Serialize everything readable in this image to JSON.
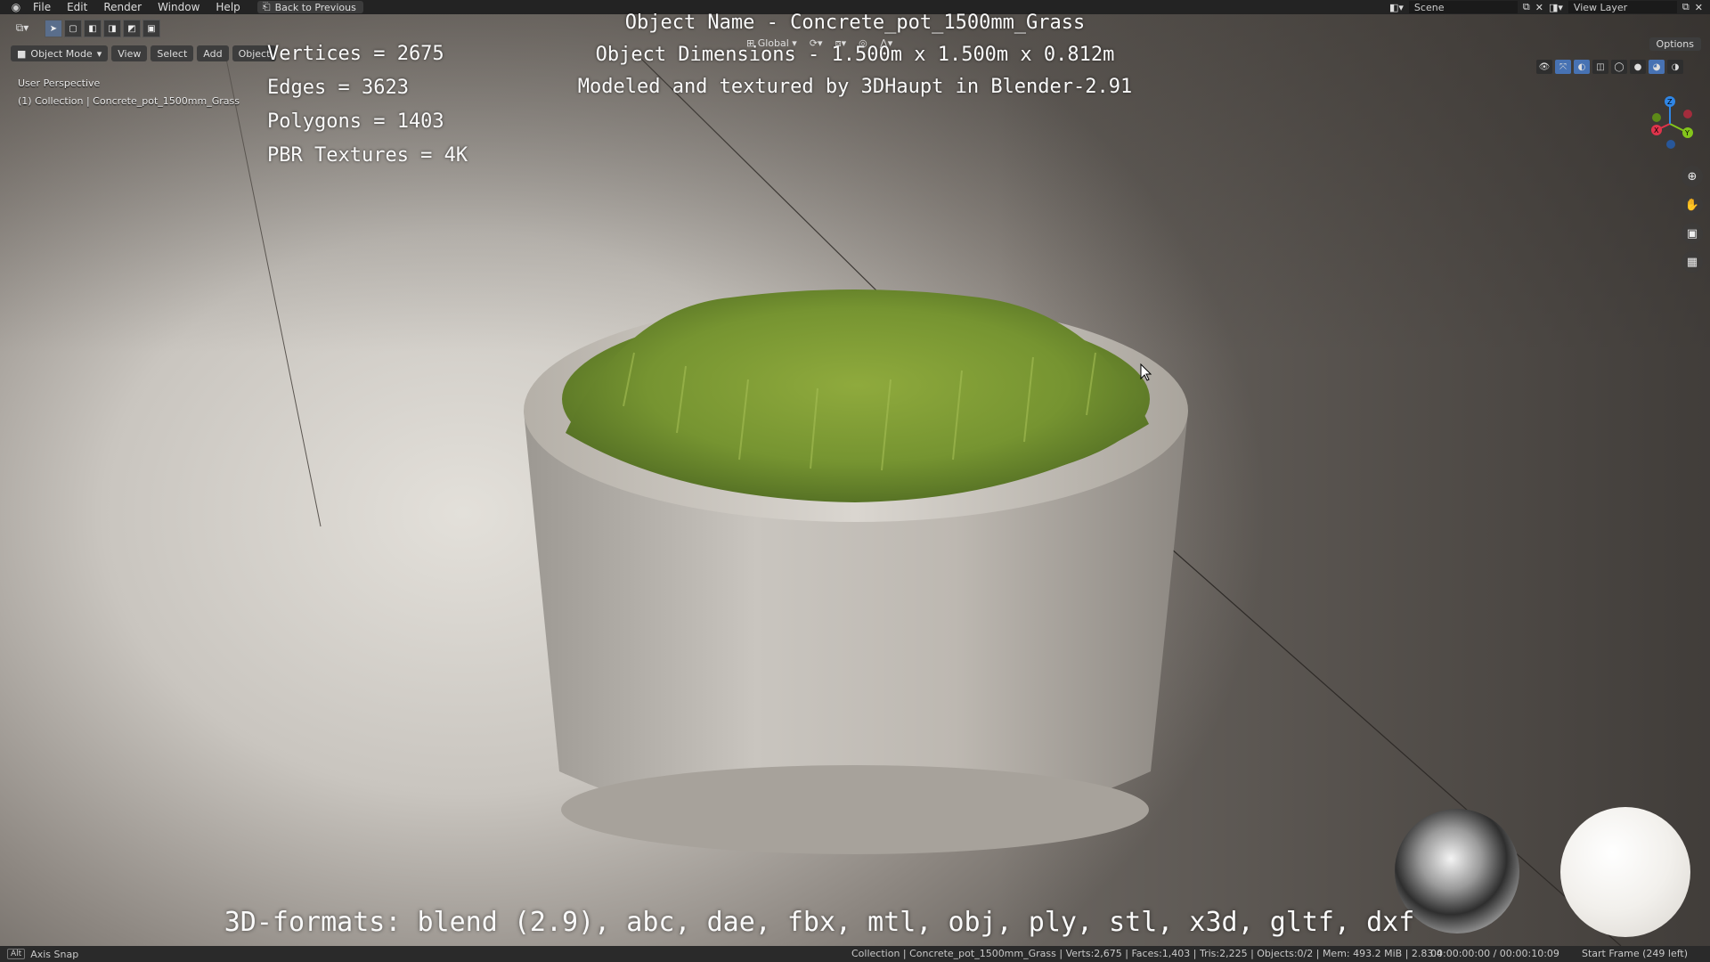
{
  "menu": {
    "items": [
      "File",
      "Edit",
      "Render",
      "Window",
      "Help"
    ],
    "back_button": "Back to Previous",
    "scene_label": "Scene",
    "view_layer_label": "View Layer"
  },
  "viewport_header": {
    "mode": "Object Mode",
    "view": "View",
    "select": "Select",
    "add": "Add",
    "object": "Object",
    "transform_orientation": "Global",
    "options": "Options"
  },
  "viewport_info": {
    "perspective": "User Perspective",
    "collection": "(1) Collection | Concrete_pot_1500mm_Grass"
  },
  "overlay": {
    "vertices": "Vertices = 2675",
    "edges": "Edges = 3623",
    "polygons": "Polygons = 1403",
    "textures": "PBR Textures = 4K",
    "object_name": "Object Name - Concrete_pot_1500mm_Grass",
    "object_dimensions": "Object Dimensions -  1.500m x 1.500m x 0.812m",
    "credit": "Modeled and textured by 3DHaupt in Blender-2.91",
    "formats": "3D-formats: blend (2.9), abc, dae, fbx, mtl, obj, ply, stl, x3d, gltf, dxf"
  },
  "statusbar": {
    "key": "Alt",
    "hint": "Axis Snap",
    "stats": "Collection | Concrete_pot_1500mm_Grass | Verts:2,675 | Faces:1,403 | Tris:2,225 | Objects:0/2 | Mem: 493.2 MiB | 2.83.4",
    "time": "00:00:00:00 / 00:00:10:09",
    "frame": "Start Frame (249 left)"
  },
  "gizmo": {
    "x_color": "#e0334b",
    "y_color": "#84c51b",
    "z_color": "#2f86e6",
    "labels": [
      "X",
      "Y",
      "Z"
    ]
  }
}
